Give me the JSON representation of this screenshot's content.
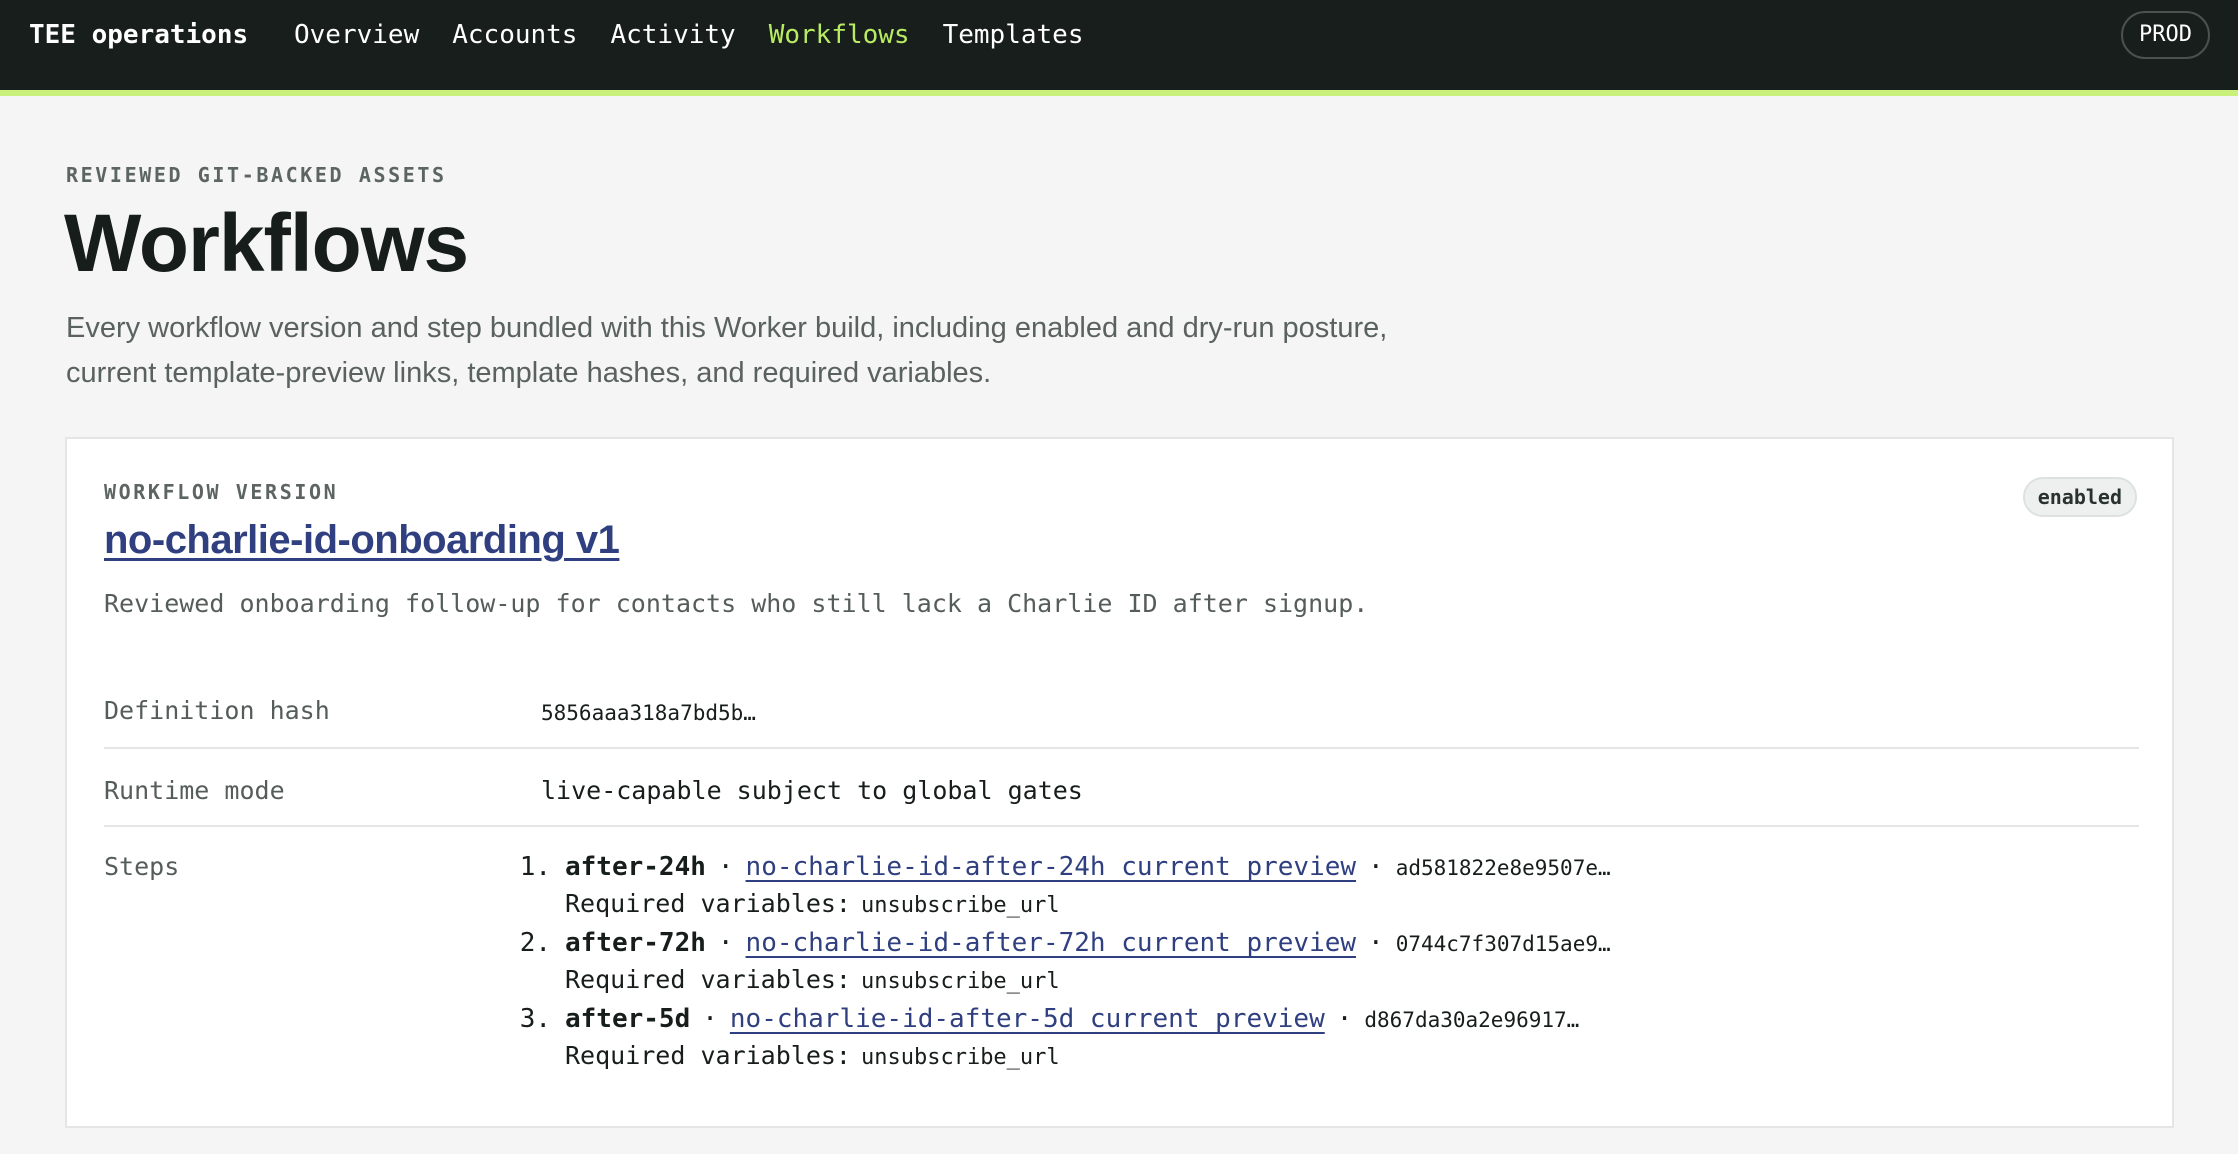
{
  "header": {
    "brand": "TEE operations",
    "nav": [
      {
        "label": "Overview",
        "active": false
      },
      {
        "label": "Accounts",
        "active": false
      },
      {
        "label": "Activity",
        "active": false
      },
      {
        "label": "Workflows",
        "active": true
      },
      {
        "label": "Templates",
        "active": false
      }
    ],
    "environment": "PROD"
  },
  "page": {
    "eyebrow": "REVIEWED GIT-BACKED ASSETS",
    "title": "Workflows",
    "lead": "Every workflow version and step bundled with this Worker build, including enabled and dry-run posture, current template-preview links, template hashes, and required variables."
  },
  "workflow": {
    "eyebrow": "WORKFLOW VERSION",
    "title": "no-charlie-id-onboarding v1",
    "status": "enabled",
    "description": "Reviewed onboarding follow-up for contacts who still lack a Charlie ID after signup.",
    "details": {
      "definition_hash_label": "Definition hash",
      "definition_hash": "5856aaa318a7bd5b…",
      "runtime_mode_label": "Runtime mode",
      "runtime_mode": "live-capable subject to global gates",
      "steps_label": "Steps"
    },
    "steps": [
      {
        "number": "1.",
        "name": "after-24h",
        "separator": "·",
        "preview_link": "no-charlie-id-after-24h current preview",
        "hash": "ad581822e8e9507e…",
        "required_label": "Required variables:",
        "required_vars": "unsubscribe_url"
      },
      {
        "number": "2.",
        "name": "after-72h",
        "separator": "·",
        "preview_link": "no-charlie-id-after-72h current preview",
        "hash": "0744c7f307d15ae9…",
        "required_label": "Required variables:",
        "required_vars": "unsubscribe_url"
      },
      {
        "number": "3.",
        "name": "after-5d",
        "separator": "·",
        "preview_link": "no-charlie-id-after-5d current preview",
        "hash": "d867da30a2e96917…",
        "required_label": "Required variables:",
        "required_vars": "unsubscribe_url"
      }
    ]
  },
  "colors": {
    "topbar": "#171e1c",
    "accent": "#b9ec62",
    "link": "#2f3f7f"
  }
}
